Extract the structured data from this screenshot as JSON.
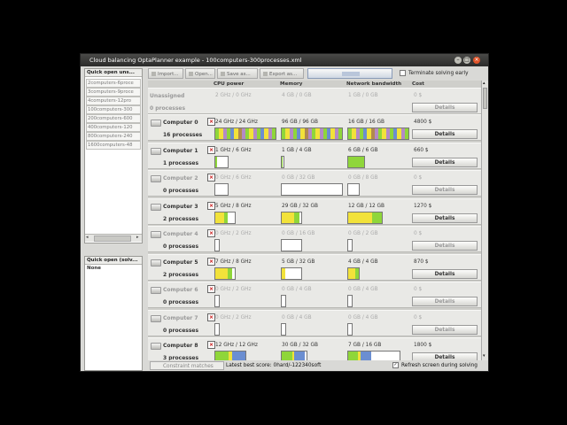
{
  "window": {
    "title": "Cloud balancing OptaPlanner example - 100computers-300processes.xml"
  },
  "left_panel": {
    "unsolved_header": "Quick open uns...",
    "unsolved_items": [
      "2computers-6proce",
      "3computers-9proce",
      "4computers-12pro",
      "100computers-300",
      "200computers-600",
      "400computers-120",
      "800computers-240",
      "1600computers-48"
    ],
    "solved_header": "Quick open (solv...",
    "solved_none": "None"
  },
  "toolbar": {
    "import": "Import...",
    "open": "Open...",
    "save": "Save as...",
    "export": "Export as...",
    "terminate": "Terminate solving early"
  },
  "columns": {
    "cpu": "CPU power",
    "memory": "Memory",
    "network": "Network bandwidth",
    "cost": "Cost"
  },
  "unassigned": {
    "name": "Unassigned",
    "cpu": "2 GHz / 0 GHz",
    "memory": "4 GB / 0 GB",
    "network": "1 GB / 0 GB",
    "cost": "0 $",
    "processes": "0 processes",
    "details": "Details"
  },
  "computers": [
    {
      "name": "Computer 0",
      "cpu": "24 GHz / 24 GHz",
      "memory": "96 GB / 96 GB",
      "network": "16 GB / 16 GB",
      "cost": "4800 $",
      "processes": "16 processes",
      "details": "Details"
    },
    {
      "name": "Computer 1",
      "cpu": "1 GHz / 6 GHz",
      "memory": "1 GB / 4 GB",
      "network": "6 GB / 6 GB",
      "cost": "660 $",
      "processes": "1 processes",
      "details": "Details"
    },
    {
      "name": "Computer 2",
      "cpu": "0 GHz / 6 GHz",
      "memory": "0 GB / 32 GB",
      "network": "0 GB / 8 GB",
      "cost": "0 $",
      "processes": "0 processes",
      "details": "Details"
    },
    {
      "name": "Computer 3",
      "cpu": "5 GHz / 8 GHz",
      "memory": "29 GB / 32 GB",
      "network": "12 GB / 12 GB",
      "cost": "1270 $",
      "processes": "2 processes",
      "details": "Details"
    },
    {
      "name": "Computer 4",
      "cpu": "0 GHz / 2 GHz",
      "memory": "0 GB / 16 GB",
      "network": "0 GB / 2 GB",
      "cost": "0 $",
      "processes": "0 processes",
      "details": "Details"
    },
    {
      "name": "Computer 5",
      "cpu": "7 GHz / 8 GHz",
      "memory": "5 GB / 32 GB",
      "network": "4 GB / 4 GB",
      "cost": "870 $",
      "processes": "2 processes",
      "details": "Details"
    },
    {
      "name": "Computer 6",
      "cpu": "0 GHz / 2 GHz",
      "memory": "0 GB / 4 GB",
      "network": "0 GB / 4 GB",
      "cost": "0 $",
      "processes": "0 processes",
      "details": "Details"
    },
    {
      "name": "Computer 7",
      "cpu": "0 GHz / 2 GHz",
      "memory": "0 GB / 4 GB",
      "network": "0 GB / 4 GB",
      "cost": "0 $",
      "processes": "0 processes",
      "details": "Details"
    },
    {
      "name": "Computer 8",
      "cpu": "12 GHz / 12 GHz",
      "memory": "30 GB / 32 GB",
      "network": "7 GB / 16 GB",
      "cost": "1800 $",
      "processes": "3 processes",
      "details": "Details"
    }
  ],
  "status": {
    "constraint_matches": "Constraint matches",
    "latest_best_score": "Latest best score: 0hard/-122340soft",
    "refresh": "Refresh screen during solving"
  },
  "colors": {
    "green": "#8fd63a",
    "yellow": "#f2e23a",
    "purple": "#b48ac6",
    "blue": "#6b8ed1",
    "brown": "#b08a4f"
  }
}
